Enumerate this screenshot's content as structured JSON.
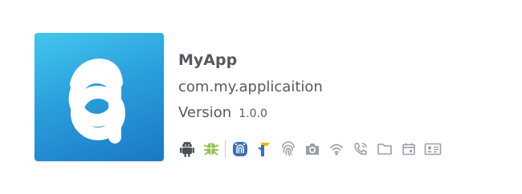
{
  "app": {
    "name": "MyApp",
    "package": "com.my.applicaition",
    "version_label": "Version",
    "version_number": "1.0.0"
  },
  "icon": {
    "letter": "a",
    "gradient": [
      "#43c7ee",
      "#1a78c6"
    ]
  },
  "feature_icons": [
    "android-robot-icon",
    "android-bug-icon",
    "fingerprint-app-icon",
    "flag-logo-icon",
    "fingerprint-icon",
    "camera-icon",
    "wifi-icon",
    "phone-icon",
    "folder-icon",
    "calendar-icon",
    "contact-card-icon"
  ],
  "colors": {
    "text": "#555a5e",
    "android_dark": "#4a4f54",
    "android_green": "#8bc34a",
    "app_blue": "#3d6fb8",
    "logo_yellow": "#f3b800",
    "permission_gray": "#9aa0a6"
  }
}
